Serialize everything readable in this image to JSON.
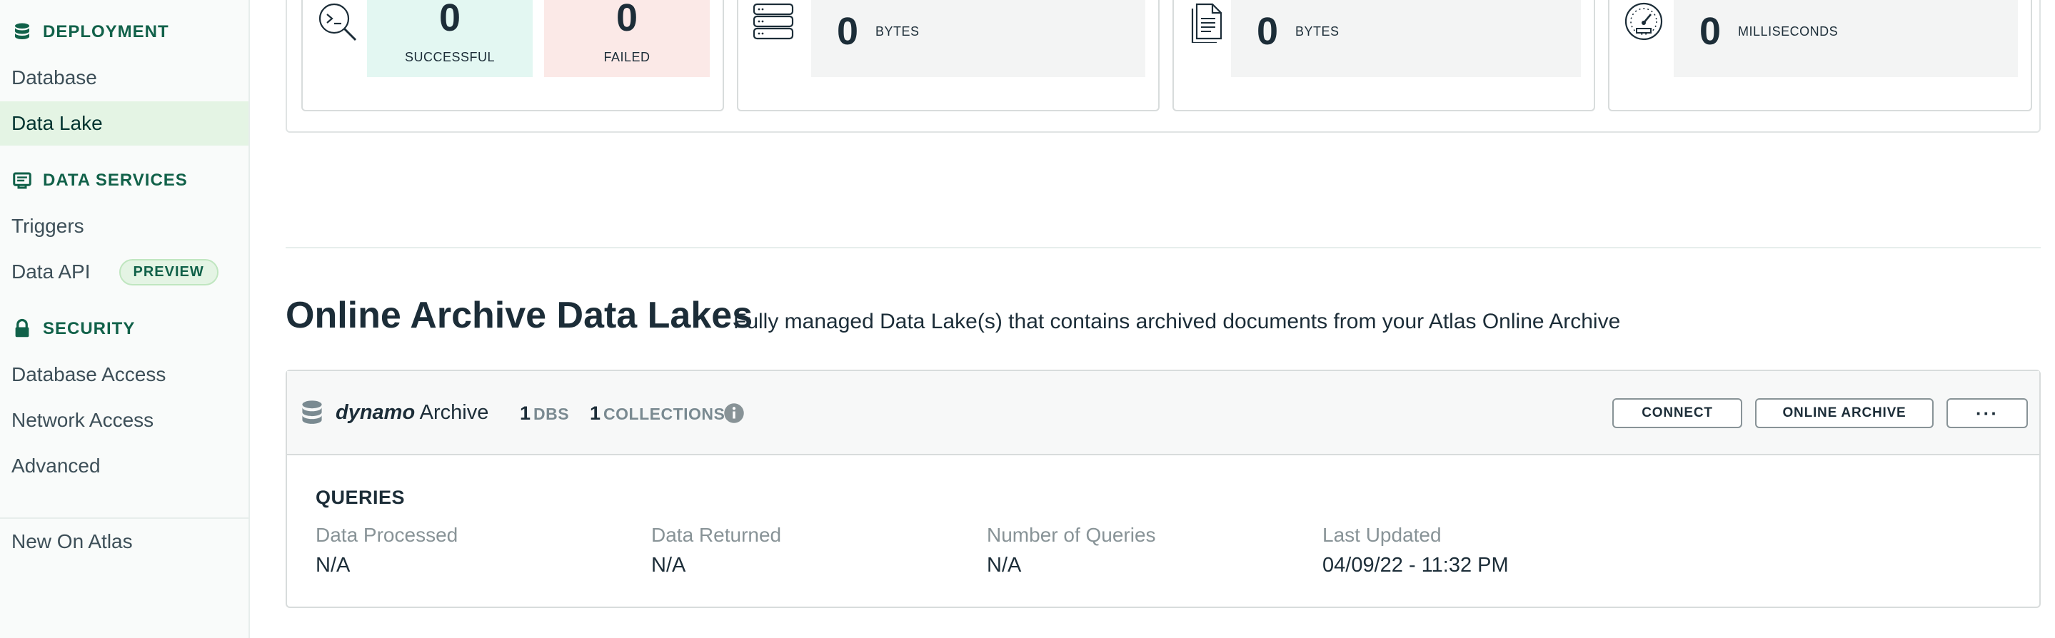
{
  "sidebar": {
    "deployment_header": "DEPLOYMENT",
    "database": "Database",
    "data_lake": "Data Lake",
    "data_services_header": "DATA SERVICES",
    "triggers": "Triggers",
    "data_api": "Data API",
    "preview_badge": "PREVIEW",
    "security_header": "SECURITY",
    "database_access": "Database Access",
    "network_access": "Network Access",
    "advanced": "Advanced",
    "new_on_atlas": "New On Atlas"
  },
  "stats": {
    "successful_value": "0",
    "successful_label": "SUCCESSFUL",
    "failed_value": "0",
    "failed_label": "FAILED",
    "processed_value": "0",
    "processed_unit": "BYTES",
    "returned_value": "0",
    "returned_unit": "BYTES",
    "time_value": "0",
    "time_unit": "MILLISECONDS"
  },
  "section": {
    "title": "Online Archive Data Lakes",
    "subtitle": "Fully managed Data Lake(s) that contains archived documents from your Atlas Online Archive"
  },
  "lake": {
    "name_italic": "dynamo",
    "name_rest": "Archive",
    "dbs_count": "1",
    "dbs_label": "DBS",
    "collections_count": "1",
    "collections_label": "COLLECTIONS",
    "connect_button": "CONNECT",
    "online_archive_button": "ONLINE ARCHIVE",
    "more_button": "···",
    "queries_title": "QUERIES",
    "columns": [
      {
        "label": "Data Processed",
        "value": "N/A"
      },
      {
        "label": "Data Returned",
        "value": "N/A"
      },
      {
        "label": "Number of Queries",
        "value": "N/A"
      },
      {
        "label": "Last Updated",
        "value": "04/09/22 - 11:32 PM"
      }
    ]
  },
  "colors": {
    "accent_green": "#116149",
    "success_bg": "#e3f7f2",
    "failed_bg": "#fbe9e7",
    "stat_bg": "#f3f4f4"
  }
}
